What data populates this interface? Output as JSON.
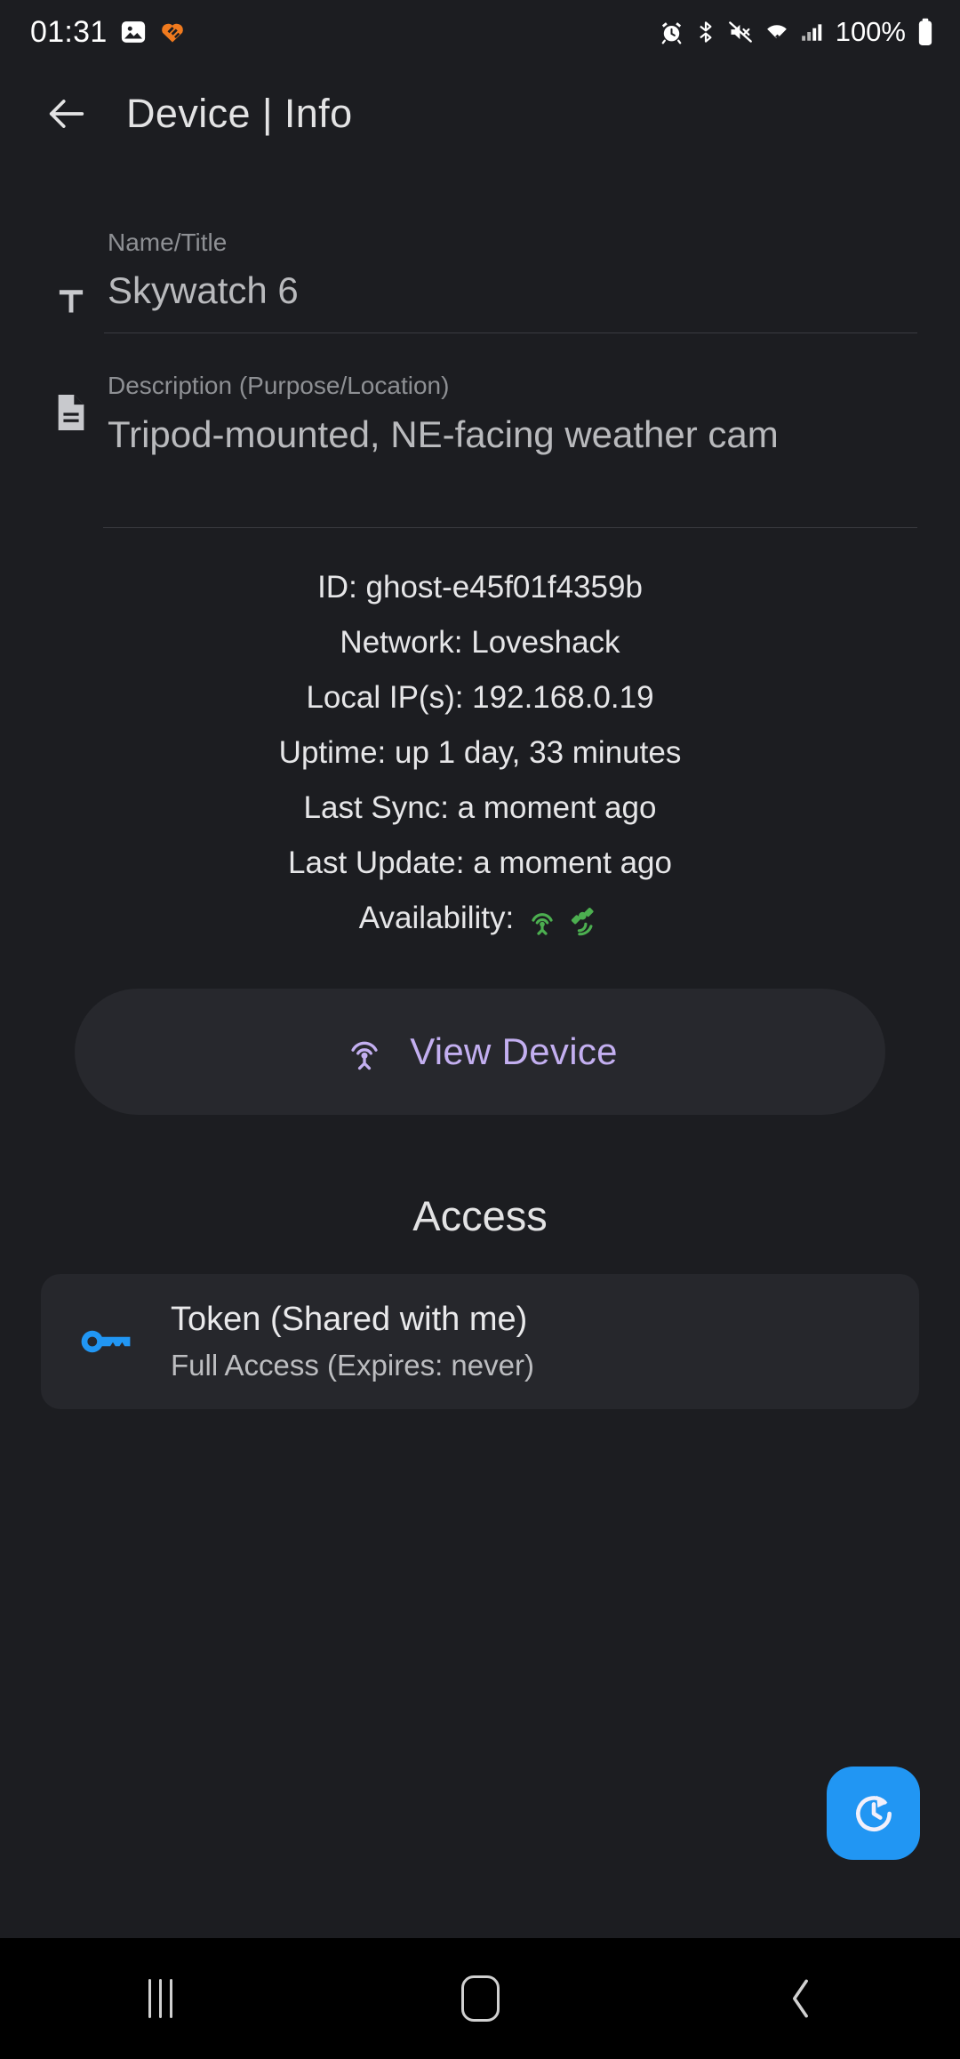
{
  "status_bar": {
    "time": "01:31",
    "battery": "100%",
    "left_icons": [
      "photo-icon",
      "orange-heart-icon"
    ],
    "right_icons": [
      "alarm-icon",
      "bluetooth-icon",
      "mute-icon",
      "wifi-icon",
      "cellular-signal-icon",
      "battery-icon"
    ]
  },
  "app_bar": {
    "back_icon": "back-arrow-icon",
    "title": "Device | Info"
  },
  "fields": {
    "name": {
      "icon": "text-format-icon",
      "label": "Name/Title",
      "value": "Skywatch 6"
    },
    "description": {
      "icon": "document-icon",
      "label": "Description (Purpose/Location)",
      "value": "Tripod-mounted, NE-facing weather cam"
    }
  },
  "info": {
    "lines": [
      "ID: ghost-e45f01f4359b",
      "Network: Loveshack",
      "Local IP(s): 192.168.0.19",
      "Uptime: up 1 day, 33 minutes",
      "Last Sync: a moment ago",
      "Last Update: a moment ago"
    ],
    "availability_label": "Availability:",
    "availability_icons": [
      "broadcast-tower-icon",
      "satellite-icon"
    ],
    "availability_color": "#4caf50"
  },
  "view_device_button": {
    "icon": "broadcast-tower-icon",
    "label": "View Device",
    "accent_color": "#c3aff0"
  },
  "access": {
    "section_title": "Access",
    "tokens": [
      {
        "icon": "key-icon",
        "icon_color": "#2196f3",
        "title": "Token (Shared with me)",
        "subtitle": "Full Access (Expires: never)"
      }
    ]
  },
  "fab": {
    "icon": "history-refresh-icon",
    "color": "#2196f3"
  },
  "nav_bar": {
    "recents": "recents-icon",
    "home": "home-icon",
    "back": "back-icon"
  }
}
